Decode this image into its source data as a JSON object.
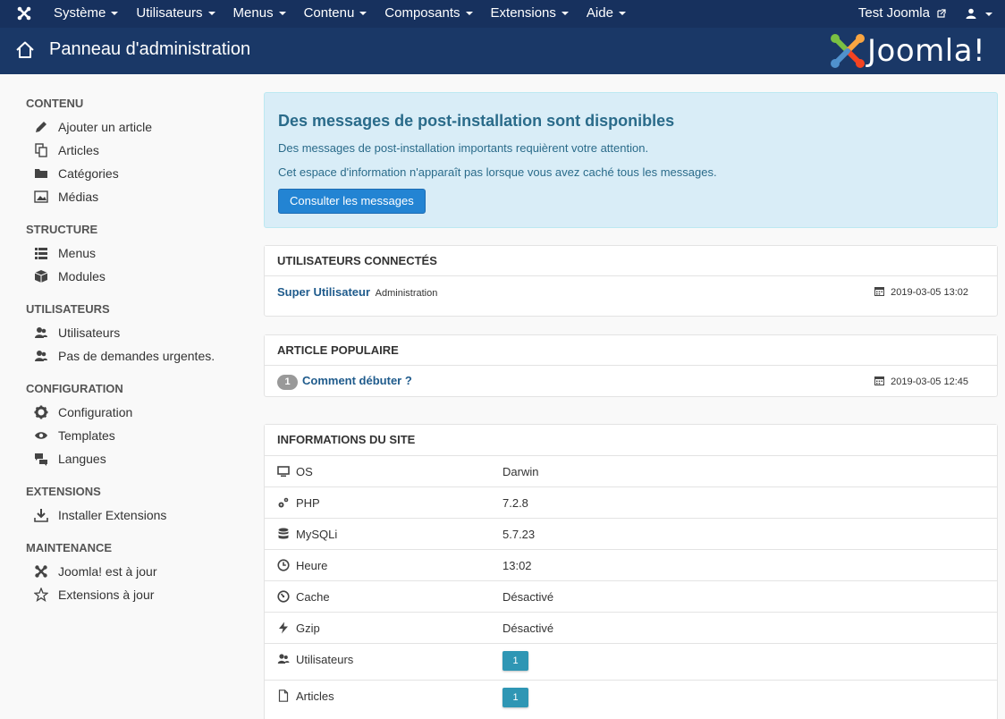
{
  "navbar": {
    "menu": [
      {
        "label": "Système"
      },
      {
        "label": "Utilisateurs"
      },
      {
        "label": "Menus"
      },
      {
        "label": "Contenu"
      },
      {
        "label": "Composants"
      },
      {
        "label": "Extensions"
      },
      {
        "label": "Aide"
      }
    ],
    "site_label": "Test Joomla"
  },
  "header": {
    "title": "Panneau d'administration",
    "brand": "Joomla!"
  },
  "sidebar": {
    "sections": [
      {
        "heading": "CONTENU",
        "items": [
          {
            "label": "Ajouter un article",
            "icon": "pencil-icon"
          },
          {
            "label": "Articles",
            "icon": "copy-icon"
          },
          {
            "label": "Catégories",
            "icon": "folder-icon"
          },
          {
            "label": "Médias",
            "icon": "image-icon"
          }
        ]
      },
      {
        "heading": "STRUCTURE",
        "items": [
          {
            "label": "Menus",
            "icon": "list-icon"
          },
          {
            "label": "Modules",
            "icon": "cube-icon"
          }
        ]
      },
      {
        "heading": "UTILISATEURS",
        "items": [
          {
            "label": "Utilisateurs",
            "icon": "users-icon"
          },
          {
            "label": "Pas de demandes urgentes.",
            "icon": "users-icon"
          }
        ]
      },
      {
        "heading": "CONFIGURATION",
        "items": [
          {
            "label": "Configuration",
            "icon": "gear-icon"
          },
          {
            "label": "Templates",
            "icon": "eye-icon"
          },
          {
            "label": "Langues",
            "icon": "comments-icon"
          }
        ]
      },
      {
        "heading": "EXTENSIONS",
        "items": [
          {
            "label": "Installer Extensions",
            "icon": "download-icon"
          }
        ]
      },
      {
        "heading": "MAINTENANCE",
        "items": [
          {
            "label": "Joomla! est à jour",
            "icon": "joomla-icon"
          },
          {
            "label": "Extensions à jour",
            "icon": "star-icon"
          }
        ]
      }
    ]
  },
  "alert": {
    "title": "Des messages de post-installation sont disponibles",
    "line1": "Des messages de post-installation importants requièrent votre attention.",
    "line2": "Cet espace d'information n'apparaît pas lorsque vous avez caché tous les messages.",
    "button": "Consulter les messages"
  },
  "logged_users": {
    "heading": "UTILISATEURS CONNECTÉS",
    "user": "Super Utilisateur",
    "context": "Administration",
    "date": "2019-03-05 13:02"
  },
  "popular": {
    "heading": "ARTICLE POPULAIRE",
    "hits": "1",
    "title": "Comment débuter ?",
    "date": "2019-03-05 12:45"
  },
  "site_info": {
    "heading": "INFORMATIONS DU SITE",
    "rows": [
      {
        "label": "OS",
        "value": "Darwin",
        "icon": "desktop-icon"
      },
      {
        "label": "PHP",
        "value": "7.2.8",
        "icon": "cogs-icon"
      },
      {
        "label": "MySQLi",
        "value": "5.7.23",
        "icon": "database-icon"
      },
      {
        "label": "Heure",
        "value": "13:02",
        "icon": "clock-icon"
      },
      {
        "label": "Cache",
        "value": "Désactivé",
        "icon": "dashboard-icon"
      },
      {
        "label": "Gzip",
        "value": "Désactivé",
        "icon": "lightning-icon"
      },
      {
        "label": "Utilisateurs",
        "value": "1",
        "icon": "users-icon"
      },
      {
        "label": "Articles",
        "value": "1",
        "icon": "file-icon"
      }
    ]
  }
}
